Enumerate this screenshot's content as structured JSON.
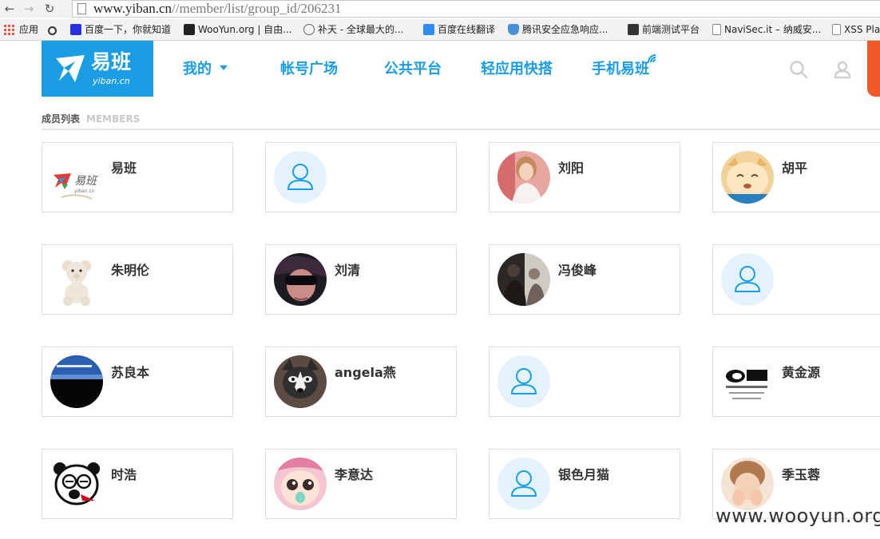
{
  "browser": {
    "url_host": "www.yiban.cn",
    "url_path": "//member/list/group_id/206231",
    "bookmarks": [
      {
        "label": "应用",
        "icon": "apps-grid-icon"
      },
      {
        "label": "百度一下，你就知道",
        "icon": "baidu-paw-icon"
      },
      {
        "label": "WooYun.org | 自由...",
        "icon": "wooyun-icon"
      },
      {
        "label": "补天 - 全球最大的...",
        "icon": "butian-icon"
      },
      {
        "label": "百度在线翻译",
        "icon": "translate-icon"
      },
      {
        "label": "腾讯安全应急响应...",
        "icon": "shield-icon"
      },
      {
        "label": "前端测试平台",
        "icon": "bug-icon"
      },
      {
        "label": "NaviSec.it – 纳威安...",
        "icon": "page-icon"
      },
      {
        "label": "XSS Pla",
        "icon": "page-icon"
      }
    ]
  },
  "header": {
    "logo_text": "易班",
    "logo_sub": "yiban.cn",
    "nav": [
      {
        "label": "我的"
      },
      {
        "label": "帐号广场"
      },
      {
        "label": "公共平台"
      },
      {
        "label": "轻应用快搭"
      },
      {
        "label": "手机易班"
      }
    ],
    "accent": "#1a9de3"
  },
  "section": {
    "title": "成员列表",
    "subtitle": "MEMBERS"
  },
  "members": [
    {
      "name": "易班",
      "avatar": "yiban-logo"
    },
    {
      "name": "",
      "avatar": "default"
    },
    {
      "name": "刘阳",
      "avatar": "photo-girl"
    },
    {
      "name": "胡平",
      "avatar": "cartoon-cat"
    },
    {
      "name": "朱明伦",
      "avatar": "teddy-bear"
    },
    {
      "name": "刘清",
      "avatar": "photo-dark"
    },
    {
      "name": "冯俊峰",
      "avatar": "photo-couple"
    },
    {
      "name": "",
      "avatar": "default"
    },
    {
      "name": "苏良本",
      "avatar": "banner-black"
    },
    {
      "name": "angela燕",
      "avatar": "husky"
    },
    {
      "name": "",
      "avatar": "default"
    },
    {
      "name": "黄金源",
      "avatar": "lyingsong-logo"
    },
    {
      "name": "时浩",
      "avatar": "panda-cartoon"
    },
    {
      "name": "李意达",
      "avatar": "cartoon-face"
    },
    {
      "name": "银色月猫",
      "avatar": "default"
    },
    {
      "name": "季玉蓉",
      "avatar": "photo-girl-hands"
    }
  ],
  "watermark": "www.wooyun.org"
}
